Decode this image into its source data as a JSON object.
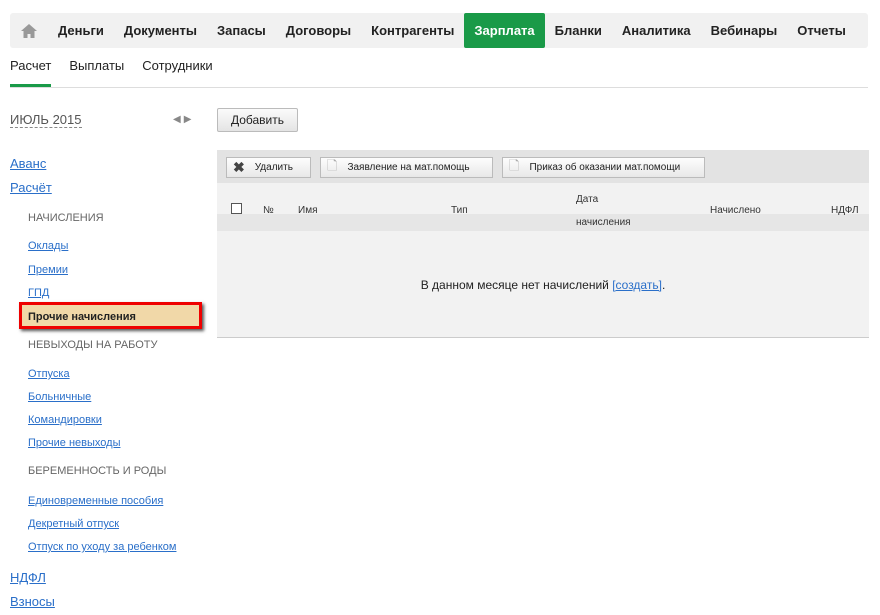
{
  "topnav": {
    "items": [
      "Деньги",
      "Документы",
      "Запасы",
      "Договоры",
      "Контрагенты",
      "Зарплата",
      "Бланки",
      "Аналитика",
      "Вебинары",
      "Отчеты"
    ],
    "active": "Зарплата"
  },
  "subnav": [
    "Расчет",
    "Выплаты",
    "Сотрудники"
  ],
  "period": "ИЮЛЬ 2015",
  "sidebar": {
    "avans": "Аванс",
    "raschet": "Расчёт",
    "h1": "НАЧИСЛЕНИЯ",
    "oklady": "Оклады",
    "premii": "Премии",
    "gpd": "ГПД",
    "prochie": "Прочие начисления",
    "h2": "НЕВЫХОДЫ НА РАБОТУ",
    "otpuska": "Отпуска",
    "bolnichnye": "Больничные",
    "komandirovki": "Командировки",
    "prochie_nevyhody": "Прочие невыходы",
    "h3": "БЕРЕМЕННОСТЬ И РОДЫ",
    "edinovremennye": "Единовременные пособия",
    "dekret": "Декретный отпуск",
    "uhod": "Отпуск по уходу за ребенком",
    "ndfl": "НДФЛ",
    "vznosy": "Взносы"
  },
  "add_button": "Добавить",
  "toolbar": {
    "delete": "Удалить",
    "zayavlenie": "Заявление на мат.помощь",
    "prikaz": "Приказ об оказании мат.помощи"
  },
  "table": {
    "num": "№",
    "name": "Имя",
    "type": "Тип",
    "date1": "Дата",
    "date2": "начисления",
    "accrued": "Начислено",
    "ndfl": "НДФЛ"
  },
  "empty": {
    "text": "В данном месяце нет начислений ",
    "link": "[создать]",
    "end": "."
  }
}
